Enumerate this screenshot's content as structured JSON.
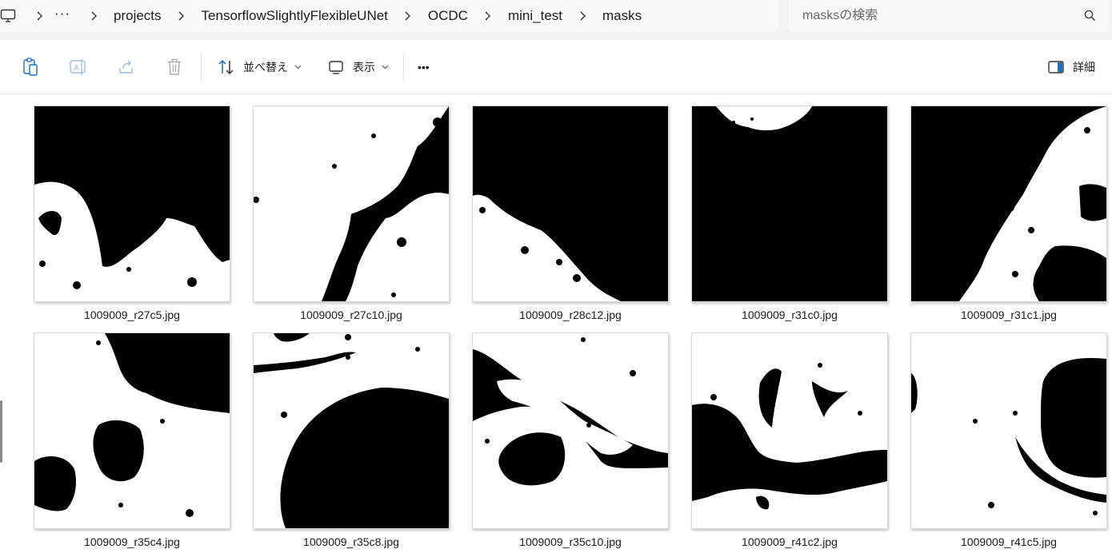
{
  "breadcrumb": {
    "items": [
      {
        "label": "projects"
      },
      {
        "label": "TensorflowSlightlyFlexibleUNet"
      },
      {
        "label": "OCDC"
      },
      {
        "label": "mini_test"
      },
      {
        "label": "masks"
      }
    ],
    "overflow": "···"
  },
  "search": {
    "placeholder": "masksの検索"
  },
  "toolbar": {
    "sort_label": "並べ替え",
    "view_label": "表示",
    "more_label": "•••",
    "details_label": "詳細"
  },
  "files": [
    {
      "name": "1009009_r27c5.jpg"
    },
    {
      "name": "1009009_r27c10.jpg"
    },
    {
      "name": "1009009_r28c12.jpg"
    },
    {
      "name": "1009009_r31c0.jpg"
    },
    {
      "name": "1009009_r31c1.jpg"
    },
    {
      "name": "1009009_r35c4.jpg"
    },
    {
      "name": "1009009_r35c8.jpg"
    },
    {
      "name": "1009009_r35c10.jpg"
    },
    {
      "name": "1009009_r41c2.jpg"
    },
    {
      "name": "1009009_r41c5.jpg"
    }
  ],
  "colors": {
    "accent": "#0067c0",
    "mask_foreground": "#ffffff",
    "mask_background": "#000000"
  }
}
